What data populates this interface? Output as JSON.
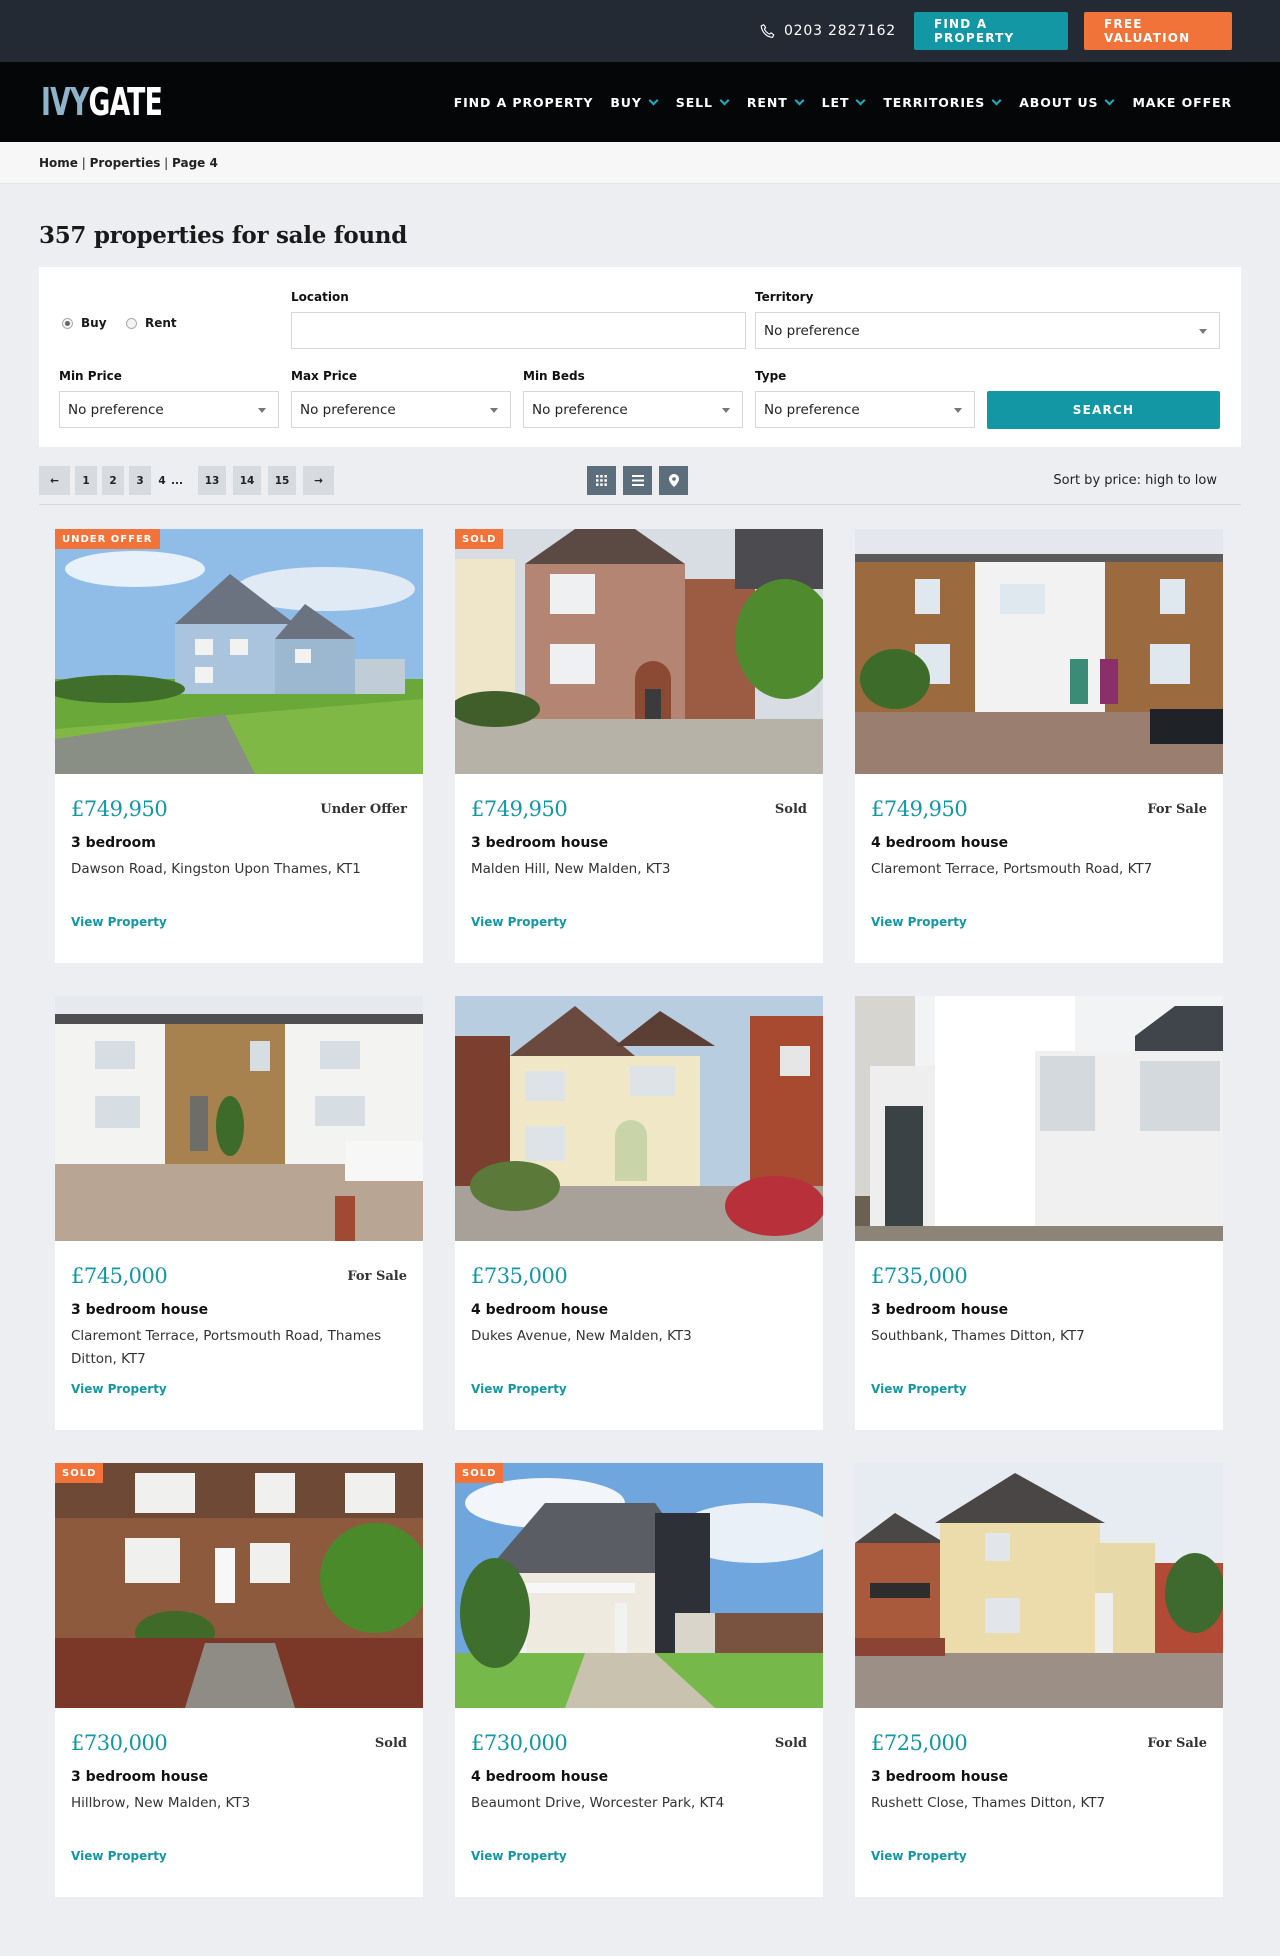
{
  "topbar": {
    "phone": "0203 2827162",
    "find_btn": "FIND A PROPERTY",
    "valuation_btn": "FREE VALUATION",
    "colors": {
      "teal": "#1497a4",
      "orange": "#f2733a",
      "dark": "#232a33"
    }
  },
  "nav": {
    "logo_part1": "IVY",
    "logo_part2": "GATE",
    "items": [
      {
        "label": "FIND A PROPERTY",
        "dropdown": false
      },
      {
        "label": "BUY",
        "dropdown": true
      },
      {
        "label": "SELL",
        "dropdown": true
      },
      {
        "label": "RENT",
        "dropdown": true
      },
      {
        "label": "LET",
        "dropdown": true
      },
      {
        "label": "TERRITORIES",
        "dropdown": true
      },
      {
        "label": "ABOUT US",
        "dropdown": true
      },
      {
        "label": "MAKE OFFER",
        "dropdown": false
      }
    ]
  },
  "breadcrumb": {
    "home": "Home",
    "properties": "Properties",
    "page": "Page 4"
  },
  "page_title": "357 properties for sale found",
  "search": {
    "buy_label": "Buy",
    "rent_label": "Rent",
    "location_label": "Location",
    "location_value": "",
    "territory_label": "Territory",
    "territory_value": "No preference",
    "min_price_label": "Min Price",
    "min_price_value": "No preference",
    "max_price_label": "Max Price",
    "max_price_value": "No preference",
    "min_beds_label": "Min Beds",
    "min_beds_value": "No preference",
    "type_label": "Type",
    "type_value": "No preference",
    "search_btn": "SEARCH"
  },
  "pagination": {
    "prev": "←",
    "pages": [
      "1",
      "2",
      "3"
    ],
    "current": "4",
    "ellipsis": "...",
    "pages_after": [
      "13",
      "14",
      "15"
    ],
    "next": "→"
  },
  "view_icons": [
    "grid-view-icon",
    "list-view-icon",
    "map-pin-icon"
  ],
  "sort_label": "Sort by price: high to low",
  "listings": [
    {
      "badge": "UNDER OFFER",
      "price": "£749,950",
      "status": "Under Offer",
      "beds": "3 bedroom",
      "address": "Dawson Road, Kingston Upon Thames, KT1",
      "link": "View Property"
    },
    {
      "badge": "SOLD",
      "price": "£749,950",
      "status": "Sold",
      "beds": "3 bedroom house",
      "address": "Malden Hill, New Malden, KT3",
      "link": "View Property"
    },
    {
      "badge": "",
      "price": "£749,950",
      "status": "For Sale",
      "beds": "4 bedroom house",
      "address": "Claremont Terrace, Portsmouth Road, KT7",
      "link": "View Property"
    },
    {
      "badge": "",
      "price": "£745,000",
      "status": "For Sale",
      "beds": "3 bedroom house",
      "address": "Claremont Terrace, Portsmouth Road, Thames Ditton, KT7",
      "link": "View Property"
    },
    {
      "badge": "",
      "price": "£735,000",
      "status": "",
      "beds": "4 bedroom house",
      "address": "Dukes Avenue, New Malden, KT3",
      "link": "View Property"
    },
    {
      "badge": "",
      "price": "£735,000",
      "status": "",
      "beds": "3 bedroom house",
      "address": "Southbank, Thames Ditton, KT7",
      "link": "View Property"
    },
    {
      "badge": "SOLD",
      "price": "£730,000",
      "status": "Sold",
      "beds": "3 bedroom house",
      "address": "Hillbrow, New Malden, KT3",
      "link": "View Property"
    },
    {
      "badge": "SOLD",
      "price": "£730,000",
      "status": "Sold",
      "beds": "4 bedroom house",
      "address": "Beaumont Drive, Worcester Park, KT4",
      "link": "View Property"
    },
    {
      "badge": "",
      "price": "£725,000",
      "status": "For Sale",
      "beds": "3 bedroom house",
      "address": "Rushett Close, Thames Ditton, KT7",
      "link": "View Property"
    }
  ]
}
